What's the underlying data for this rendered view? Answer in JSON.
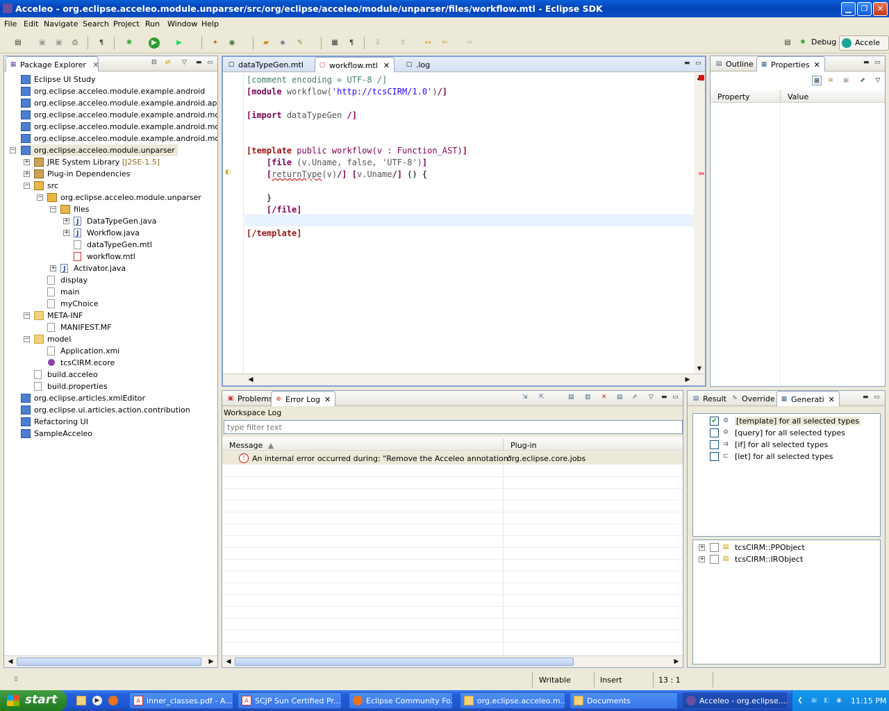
{
  "window": {
    "title": "Acceleo - org.eclipse.acceleo.module.unparser/src/org/eclipse/acceleo/module/unparser/files/workflow.mtl - Eclipse SDK"
  },
  "menu": [
    "File",
    "Edit",
    "Navigate",
    "Search",
    "Project",
    "Run",
    "Window",
    "Help"
  ],
  "perspectives": {
    "debug": "Debug",
    "acceleo": "Accele"
  },
  "explorer": {
    "tab": "Package Explorer",
    "items": [
      "Eclipse UI Study",
      "org.eclipse.acceleo.module.example.android",
      "org.eclipse.acceleo.module.example.android.applicatio",
      "org.eclipse.acceleo.module.example.android.model",
      "org.eclipse.acceleo.module.example.android.model.ed",
      "org.eclipse.acceleo.module.example.android.model.ed",
      "org.eclipse.acceleo.module.unparser",
      "JRE System Library",
      "[J2SE-1.5]",
      "Plug-in Dependencies",
      "src",
      "org.eclipse.acceleo.module.unparser",
      "files",
      "DataTypeGen.java",
      "Workflow.java",
      "dataTypeGen.mtl",
      "workflow.mtl",
      "Activator.java",
      "display",
      "main",
      "myChoice",
      "META-INF",
      "MANIFEST.MF",
      "model",
      "Application.xmi",
      "tcsCIRM.ecore",
      "build.acceleo",
      "build.properties",
      "org.eclipse.articles.xmlEditor",
      "org.eclipse.ui.articles.action.contribution",
      "Refactoring UI",
      "SampleAcceleo"
    ]
  },
  "editor": {
    "tabs": [
      "dataTypeGen.mtl",
      "workflow.mtl",
      ".log"
    ],
    "lines": [
      "[comment encoding = UTF-8 /]",
      "[module workflow('http://tcsCIRM/1.0')/]",
      "",
      "[import dataTypeGen /]",
      "",
      "",
      "[template public workflow(v : Function_AST)]",
      "    [file (v.Uname, false, 'UTF-8')]",
      "    [returnType(v)/] [v.Uname/] () {",
      "",
      "    }",
      "    [/file]",
      "",
      "[/template]"
    ]
  },
  "properties": {
    "tabs": [
      "Outline",
      "Properties"
    ],
    "col_property": "Property",
    "col_value": "Value"
  },
  "errorlog": {
    "tabs": [
      "Problems",
      "Error Log"
    ],
    "workspace_label": "Workspace Log",
    "filter_placeholder": "type filter text",
    "col_message": "Message",
    "col_plugin": "Plug-in",
    "rows": [
      {
        "message": "An internal error occurred during: \"Remove the Acceleo annotation\".",
        "plugin": "org.eclipse.core.jobs"
      }
    ]
  },
  "generation": {
    "tabs": [
      "Result",
      "Override",
      "Generati"
    ],
    "types": [
      "[template] for all selected types",
      "[query] for all selected types",
      "[if] for all selected types",
      "[let] for all selected types"
    ],
    "objects": [
      "tcsCIRM::PPObject",
      "tcsCIRM::IRObject"
    ]
  },
  "status": {
    "writable": "Writable",
    "insert": "Insert",
    "position": "13 : 1"
  },
  "taskbar": {
    "start": "start",
    "tasks": [
      "inner_classes.pdf - A...",
      "SCJP Sun Certified Pr...",
      "Eclipse Community Fo...",
      "org.eclipse.acceleo.m...",
      "Documents",
      "Acceleo - org.eclipse...."
    ],
    "clock": "11:15 PM"
  },
  "colors": {
    "title_bar": "#0a5fd8",
    "taskbar": "#245edb",
    "start_button": "#2f8a2f",
    "keyword": "#7f0055",
    "string": "#2a00ff",
    "comment": "#3f7f5f"
  }
}
